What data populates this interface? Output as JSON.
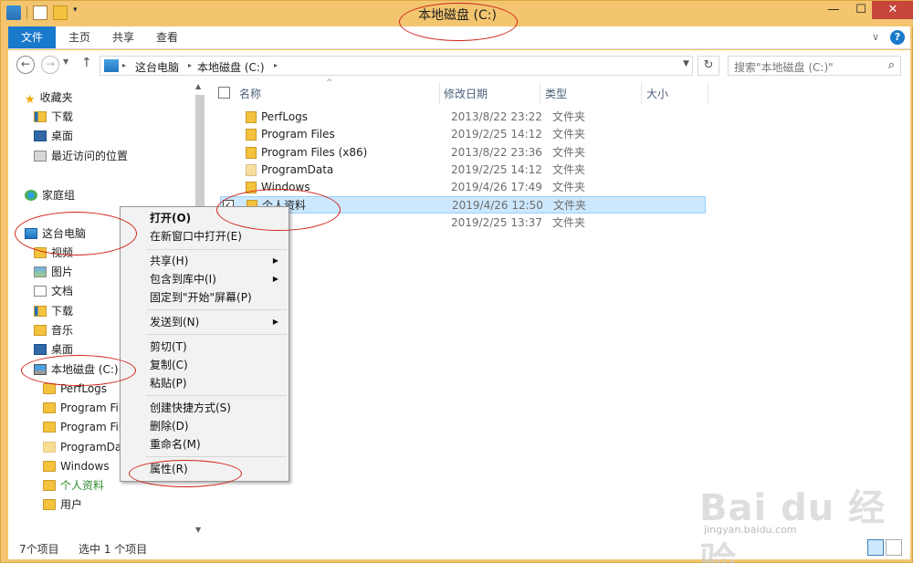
{
  "window": {
    "title": "本地磁盘 (C:)",
    "minimize": "—",
    "maximize": "☐",
    "close": "✕"
  },
  "ribbon": {
    "tabs": [
      "文件",
      "主页",
      "共享",
      "查看"
    ],
    "expand": "∨",
    "help": "?"
  },
  "address": {
    "back": "←",
    "forward": "→",
    "up": "↑",
    "crumbs": [
      "这台电脑",
      "本地磁盘 (C:)"
    ],
    "separator": "▸",
    "refresh": "↻",
    "search_placeholder": "搜索\"本地磁盘 (C:)\""
  },
  "nav": {
    "favorites": "收藏夹",
    "downloads": "下载",
    "desktop": "桌面",
    "recent": "最近访问的位置",
    "homegroup": "家庭组",
    "this_pc": "这台电脑",
    "videos": "视频",
    "pictures": "图片",
    "documents": "文档",
    "downloads2": "下载",
    "music": "音乐",
    "desktop2": "桌面",
    "drive": "本地磁盘 (C:)",
    "drive_children": [
      "PerfLogs",
      "Program Files",
      "Program Files",
      "ProgramData",
      "Windows",
      "个人资料",
      "用户"
    ]
  },
  "columns": {
    "name": "名称",
    "date": "修改日期",
    "type": "类型",
    "size": "大小"
  },
  "files": [
    {
      "name": "PerfLogs",
      "date": "2013/8/22 23:22",
      "type": "文件夹"
    },
    {
      "name": "Program Files",
      "date": "2019/2/25 14:12",
      "type": "文件夹"
    },
    {
      "name": "Program Files (x86)",
      "date": "2013/8/22 23:36",
      "type": "文件夹"
    },
    {
      "name": "ProgramData",
      "date": "2019/2/25 14:12",
      "type": "文件夹"
    },
    {
      "name": "Windows",
      "date": "2019/4/26 17:49",
      "type": "文件夹"
    },
    {
      "name": "个人资料",
      "date": "2019/4/26 12:50",
      "type": "文件夹",
      "selected": true
    },
    {
      "name": "",
      "date": "2019/2/25 13:37",
      "type": "文件夹"
    }
  ],
  "context_menu": {
    "open": "打开(O)",
    "open_new_window": "在新窗口中打开(E)",
    "share": "共享(H)",
    "include_library": "包含到库中(I)",
    "pin_start": "固定到\"开始\"屏幕(P)",
    "send_to": "发送到(N)",
    "cut": "剪切(T)",
    "copy": "复制(C)",
    "paste": "粘贴(P)",
    "create_shortcut": "创建快捷方式(S)",
    "delete": "删除(D)",
    "rename": "重命名(M)",
    "properties": "属性(R)",
    "submenu_arrow": "▶"
  },
  "status": {
    "count": "7个项目",
    "selected": "选中 1 个项目"
  },
  "watermark": {
    "brand": "Bai du 经验",
    "url": "jingyan.baidu.com"
  },
  "colors": {
    "title_bar": "#f3c56f",
    "accent": "#1979ca",
    "selection": "#cce8ff",
    "annotation": "#d0241b"
  }
}
